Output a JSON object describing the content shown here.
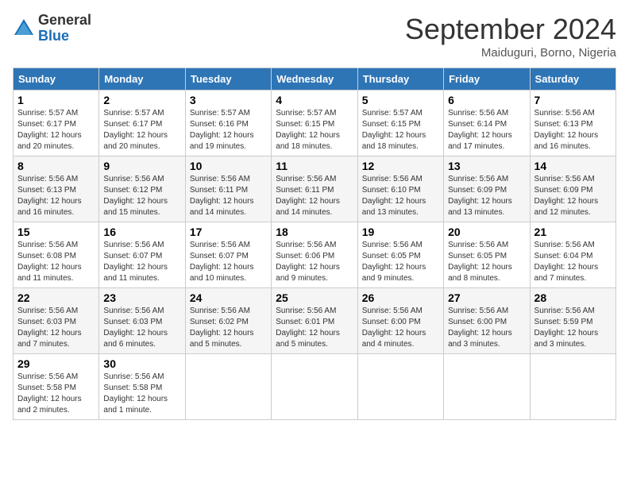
{
  "logo": {
    "line1": "General",
    "line2": "Blue"
  },
  "title": "September 2024",
  "subtitle": "Maiduguri, Borno, Nigeria",
  "days_of_week": [
    "Sunday",
    "Monday",
    "Tuesday",
    "Wednesday",
    "Thursday",
    "Friday",
    "Saturday"
  ],
  "weeks": [
    [
      {
        "num": "1",
        "sunrise": "5:57 AM",
        "sunset": "6:17 PM",
        "daylight": "12 hours and 20 minutes."
      },
      {
        "num": "2",
        "sunrise": "5:57 AM",
        "sunset": "6:17 PM",
        "daylight": "12 hours and 20 minutes."
      },
      {
        "num": "3",
        "sunrise": "5:57 AM",
        "sunset": "6:16 PM",
        "daylight": "12 hours and 19 minutes."
      },
      {
        "num": "4",
        "sunrise": "5:57 AM",
        "sunset": "6:15 PM",
        "daylight": "12 hours and 18 minutes."
      },
      {
        "num": "5",
        "sunrise": "5:57 AM",
        "sunset": "6:15 PM",
        "daylight": "12 hours and 18 minutes."
      },
      {
        "num": "6",
        "sunrise": "5:56 AM",
        "sunset": "6:14 PM",
        "daylight": "12 hours and 17 minutes."
      },
      {
        "num": "7",
        "sunrise": "5:56 AM",
        "sunset": "6:13 PM",
        "daylight": "12 hours and 16 minutes."
      }
    ],
    [
      {
        "num": "8",
        "sunrise": "5:56 AM",
        "sunset": "6:13 PM",
        "daylight": "12 hours and 16 minutes."
      },
      {
        "num": "9",
        "sunrise": "5:56 AM",
        "sunset": "6:12 PM",
        "daylight": "12 hours and 15 minutes."
      },
      {
        "num": "10",
        "sunrise": "5:56 AM",
        "sunset": "6:11 PM",
        "daylight": "12 hours and 14 minutes."
      },
      {
        "num": "11",
        "sunrise": "5:56 AM",
        "sunset": "6:11 PM",
        "daylight": "12 hours and 14 minutes."
      },
      {
        "num": "12",
        "sunrise": "5:56 AM",
        "sunset": "6:10 PM",
        "daylight": "12 hours and 13 minutes."
      },
      {
        "num": "13",
        "sunrise": "5:56 AM",
        "sunset": "6:09 PM",
        "daylight": "12 hours and 13 minutes."
      },
      {
        "num": "14",
        "sunrise": "5:56 AM",
        "sunset": "6:09 PM",
        "daylight": "12 hours and 12 minutes."
      }
    ],
    [
      {
        "num": "15",
        "sunrise": "5:56 AM",
        "sunset": "6:08 PM",
        "daylight": "12 hours and 11 minutes."
      },
      {
        "num": "16",
        "sunrise": "5:56 AM",
        "sunset": "6:07 PM",
        "daylight": "12 hours and 11 minutes."
      },
      {
        "num": "17",
        "sunrise": "5:56 AM",
        "sunset": "6:07 PM",
        "daylight": "12 hours and 10 minutes."
      },
      {
        "num": "18",
        "sunrise": "5:56 AM",
        "sunset": "6:06 PM",
        "daylight": "12 hours and 9 minutes."
      },
      {
        "num": "19",
        "sunrise": "5:56 AM",
        "sunset": "6:05 PM",
        "daylight": "12 hours and 9 minutes."
      },
      {
        "num": "20",
        "sunrise": "5:56 AM",
        "sunset": "6:05 PM",
        "daylight": "12 hours and 8 minutes."
      },
      {
        "num": "21",
        "sunrise": "5:56 AM",
        "sunset": "6:04 PM",
        "daylight": "12 hours and 7 minutes."
      }
    ],
    [
      {
        "num": "22",
        "sunrise": "5:56 AM",
        "sunset": "6:03 PM",
        "daylight": "12 hours and 7 minutes."
      },
      {
        "num": "23",
        "sunrise": "5:56 AM",
        "sunset": "6:03 PM",
        "daylight": "12 hours and 6 minutes."
      },
      {
        "num": "24",
        "sunrise": "5:56 AM",
        "sunset": "6:02 PM",
        "daylight": "12 hours and 5 minutes."
      },
      {
        "num": "25",
        "sunrise": "5:56 AM",
        "sunset": "6:01 PM",
        "daylight": "12 hours and 5 minutes."
      },
      {
        "num": "26",
        "sunrise": "5:56 AM",
        "sunset": "6:00 PM",
        "daylight": "12 hours and 4 minutes."
      },
      {
        "num": "27",
        "sunrise": "5:56 AM",
        "sunset": "6:00 PM",
        "daylight": "12 hours and 3 minutes."
      },
      {
        "num": "28",
        "sunrise": "5:56 AM",
        "sunset": "5:59 PM",
        "daylight": "12 hours and 3 minutes."
      }
    ],
    [
      {
        "num": "29",
        "sunrise": "5:56 AM",
        "sunset": "5:58 PM",
        "daylight": "12 hours and 2 minutes."
      },
      {
        "num": "30",
        "sunrise": "5:56 AM",
        "sunset": "5:58 PM",
        "daylight": "12 hours and 1 minute."
      },
      null,
      null,
      null,
      null,
      null
    ]
  ]
}
